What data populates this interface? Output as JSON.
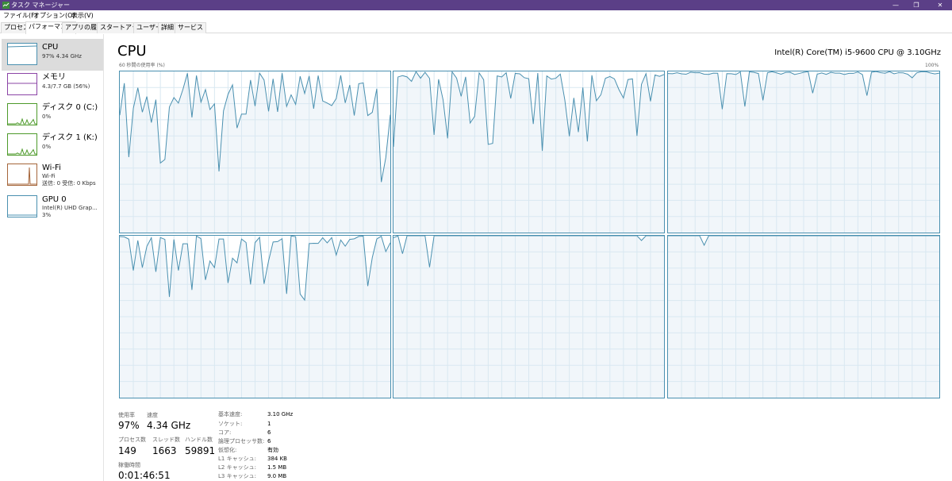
{
  "window": {
    "title": "タスク マネージャー",
    "minimize_glyph": "—",
    "restore_glyph": "❐",
    "close_glyph": "✕"
  },
  "menu": [
    "ファイル(F)",
    "オプション(O)",
    "表示(V)"
  ],
  "tabs": [
    "プロセス",
    "パフォーマンス",
    "アプリの履歴",
    "スタートアップ",
    "ユーザー",
    "詳細",
    "サービス"
  ],
  "active_tab": 1,
  "sidebar": [
    {
      "name": "CPU",
      "lines": [
        "97%  4.34 GHz"
      ],
      "color": "#4a90b0"
    },
    {
      "name": "メモリ",
      "lines": [
        "4.3/7.7 GB (56%)"
      ],
      "color": "#8b44a6"
    },
    {
      "name": "ディスク 0 (C:)",
      "lines": [
        "0%"
      ],
      "color": "#4d9a2a"
    },
    {
      "name": "ディスク 1 (K:)",
      "lines": [
        "0%"
      ],
      "color": "#4d9a2a"
    },
    {
      "name": "Wi-Fi",
      "lines": [
        "Wi-Fi",
        "送信: 0 受信: 0 Kbps"
      ],
      "color": "#a5653a"
    },
    {
      "name": "GPU 0",
      "lines": [
        "Intel(R) UHD Grap...",
        "3%"
      ],
      "color": "#4a90b0"
    }
  ],
  "main": {
    "title": "CPU",
    "cpu_model": "Intel(R) Core(TM) i5-9600 CPU @ 3.10GHz",
    "graph_label": "60 秒間の使用率 (%)",
    "graph_max": "100%",
    "accent": "#4a90b0",
    "grid_color": "#d9e8f1",
    "fill_color": "#f1f6fa"
  },
  "stats": {
    "usage_label": "使用率",
    "usage": "97%",
    "speed_label": "速度",
    "speed": "4.34 GHz",
    "processes_label": "プロセス数",
    "processes": "149",
    "threads_label": "スレッド数",
    "threads": "1663",
    "handles_label": "ハンドル数",
    "handles": "59891",
    "uptime_label": "稼働時間",
    "uptime": "0:01:46:51"
  },
  "details": [
    {
      "label": "基本速度:",
      "value": "3.10 GHz"
    },
    {
      "label": "ソケット:",
      "value": "1"
    },
    {
      "label": "コア:",
      "value": "6"
    },
    {
      "label": "論理プロセッサ数:",
      "value": "6"
    },
    {
      "label": "仮想化:",
      "value": "有効"
    },
    {
      "label": "L1 キャッシュ:",
      "value": "384 KB"
    },
    {
      "label": "L2 キャッシュ:",
      "value": "1.5 MB"
    },
    {
      "label": "L3 キャッシュ:",
      "value": "9.0 MB"
    }
  ]
}
